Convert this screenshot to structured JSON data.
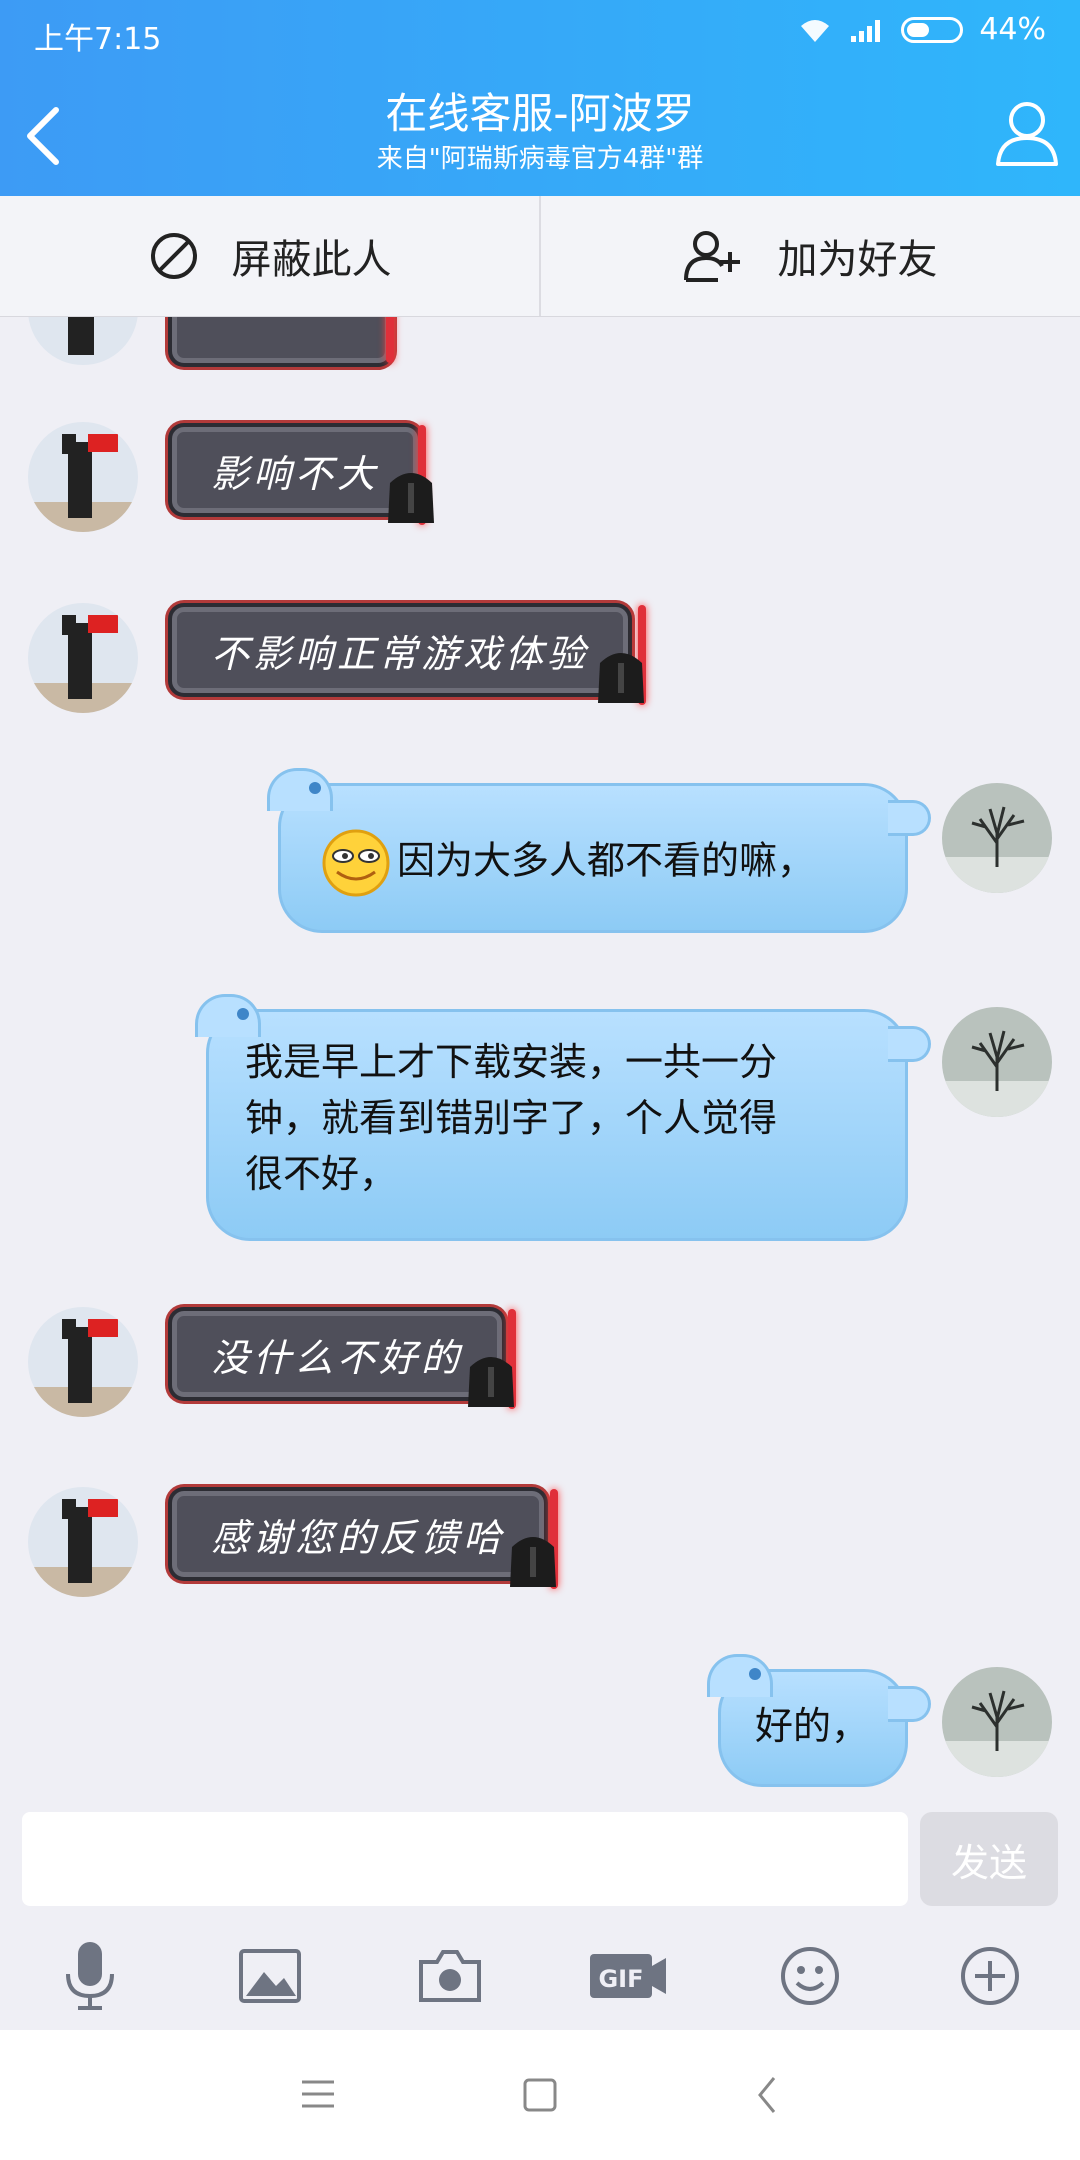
{
  "status": {
    "time": "上午7:15",
    "battery": "44%",
    "battery_level": 0.44
  },
  "header": {
    "title": "在线客服-阿波罗",
    "subtitle": "来自\"阿瑞斯病毒官方4群\"群"
  },
  "actions": {
    "block": "屏蔽此人",
    "add_friend": "加为好友"
  },
  "messages": [
    {
      "side": "in",
      "text": "影响不大"
    },
    {
      "side": "in",
      "text": "不影响正常游戏体验"
    },
    {
      "side": "out",
      "emoji": "grin-emoji",
      "text": "因为大多人都不看的嘛，"
    },
    {
      "side": "out",
      "text": "我是早上才下载安装，一共一分钟，就看到错别字了，个人觉得很不好，",
      "lines": [
        "我是早上才下载安装，一共一分",
        "钟，就看到错别字了，个人觉得",
        "很不好，"
      ]
    },
    {
      "side": "in",
      "text": "没什么不好的"
    },
    {
      "side": "in",
      "text": "感谢您的反馈哈"
    },
    {
      "side": "out",
      "text": "好的，"
    }
  ],
  "input": {
    "value": "",
    "placeholder": "",
    "send_label": "发送"
  },
  "toolbar": [
    "mic-icon",
    "image-icon",
    "camera-icon",
    "gif-icon",
    "emoji-icon",
    "plus-icon"
  ],
  "navbar": [
    "menu-icon",
    "home-icon",
    "back-icon"
  ],
  "colors": {
    "header_start": "#3d9bf5",
    "header_end": "#2fb6fb",
    "bubble_out": "#b8e0ff",
    "bubble_in": "#4f4f5a"
  }
}
